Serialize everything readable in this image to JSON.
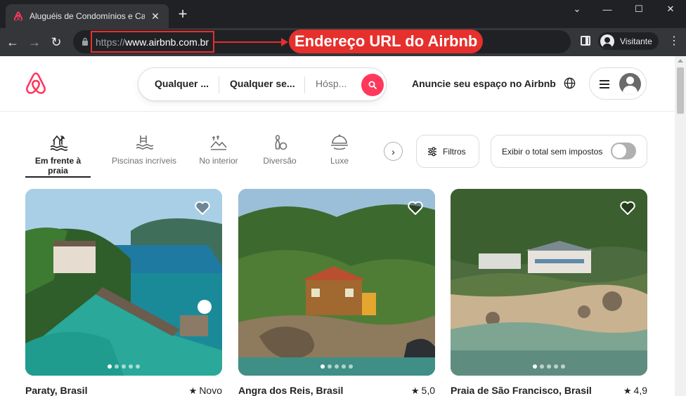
{
  "browser": {
    "tab_title": "Aluguéis de Condomínios e Casas",
    "url_scheme": "https://",
    "url_host": "www.airbnb.com.br",
    "profile_name": "Visitante"
  },
  "annotation": {
    "label": "Endereço URL do Airbnb",
    "color": "#e5302d"
  },
  "header": {
    "search": {
      "where": "Qualquer ...",
      "when": "Qualquer se...",
      "guests": "Hósp..."
    },
    "host_link": "Anuncie seu espaço no Airbnb",
    "brand_color": "#ff385c"
  },
  "categories": [
    {
      "label": "Em frente à praia",
      "icon": "beachfront-icon",
      "active": true
    },
    {
      "label": "Piscinas incríveis",
      "icon": "pool-icon",
      "active": false
    },
    {
      "label": "No interior",
      "icon": "countryside-icon",
      "active": false
    },
    {
      "label": "Diversão",
      "icon": "bowling-icon",
      "active": false
    },
    {
      "label": "Luxe",
      "icon": "luxe-icon",
      "active": false
    }
  ],
  "filters": {
    "filters_label": "Filtros",
    "tax_toggle_label": "Exibir o total sem impostos"
  },
  "listings": [
    {
      "title": "Paraty, Brasil",
      "rating": "Novo"
    },
    {
      "title": "Angra dos Reis, Brasil",
      "rating": "5,0"
    },
    {
      "title": "Praia de São Francisco, Brasil",
      "rating": "4,9"
    }
  ]
}
